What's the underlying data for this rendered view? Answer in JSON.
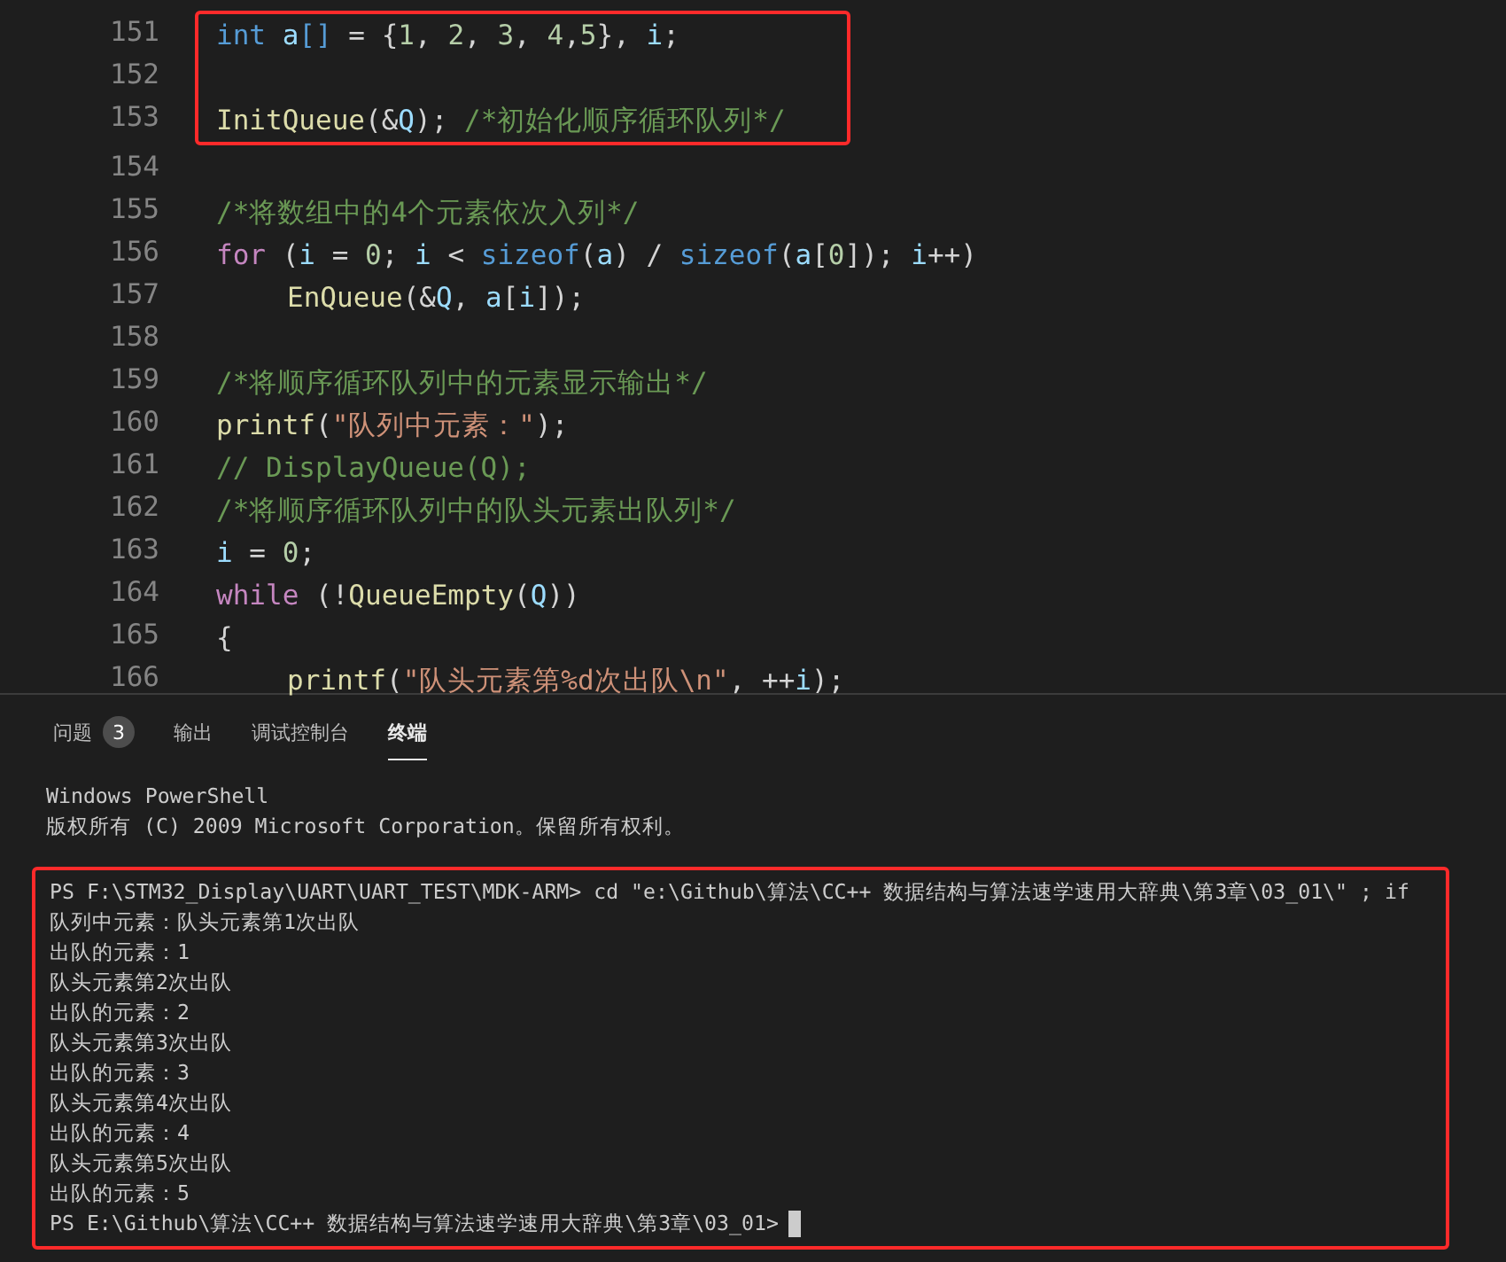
{
  "editor": {
    "lines": [
      {
        "number": "151",
        "highlighted": true,
        "tokens": [
          {
            "kind": "type",
            "text": "int"
          },
          {
            "kind": "var",
            "text": " a"
          },
          {
            "kind": "type",
            "text": "[]"
          },
          {
            "kind": "plain",
            "text": " = {"
          },
          {
            "kind": "num",
            "text": "1"
          },
          {
            "kind": "plain",
            "text": ", "
          },
          {
            "kind": "num",
            "text": "2"
          },
          {
            "kind": "plain",
            "text": ", "
          },
          {
            "kind": "num",
            "text": "3"
          },
          {
            "kind": "plain",
            "text": ", "
          },
          {
            "kind": "num",
            "text": "4"
          },
          {
            "kind": "plain",
            "text": ","
          },
          {
            "kind": "num",
            "text": "5"
          },
          {
            "kind": "plain",
            "text": "}, "
          },
          {
            "kind": "var",
            "text": "i"
          },
          {
            "kind": "plain",
            "text": ";"
          }
        ]
      },
      {
        "number": "152",
        "highlighted": true
      },
      {
        "number": "153",
        "highlighted": true,
        "tokens": [
          {
            "kind": "func",
            "text": "InitQueue"
          },
          {
            "kind": "plain",
            "text": "(&"
          },
          {
            "kind": "var",
            "text": "Q"
          },
          {
            "kind": "plain",
            "text": "); "
          },
          {
            "kind": "comment",
            "text": "/*初始化顺序循环队列*/"
          }
        ]
      },
      {
        "number": "154",
        "highlighted": false
      },
      {
        "number": "155",
        "highlighted": false,
        "tokens": [
          {
            "kind": "comment",
            "text": "/*将数组中的4个元素依次入列*/"
          }
        ]
      },
      {
        "number": "156",
        "highlighted": false,
        "tokens": [
          {
            "kind": "control",
            "text": "for"
          },
          {
            "kind": "plain",
            "text": " ("
          },
          {
            "kind": "var",
            "text": "i"
          },
          {
            "kind": "plain",
            "text": " = "
          },
          {
            "kind": "num",
            "text": "0"
          },
          {
            "kind": "plain",
            "text": "; "
          },
          {
            "kind": "var",
            "text": "i"
          },
          {
            "kind": "plain",
            "text": " < "
          },
          {
            "kind": "type",
            "text": "sizeof"
          },
          {
            "kind": "plain",
            "text": "("
          },
          {
            "kind": "var",
            "text": "a"
          },
          {
            "kind": "plain",
            "text": ") / "
          },
          {
            "kind": "type",
            "text": "sizeof"
          },
          {
            "kind": "plain",
            "text": "("
          },
          {
            "kind": "var",
            "text": "a"
          },
          {
            "kind": "plain",
            "text": "["
          },
          {
            "kind": "num",
            "text": "0"
          },
          {
            "kind": "plain",
            "text": "]); "
          },
          {
            "kind": "var",
            "text": "i"
          },
          {
            "kind": "plain",
            "text": "++)"
          }
        ]
      },
      {
        "number": "157",
        "highlighted": false,
        "indented": true,
        "tokens": [
          {
            "kind": "func",
            "text": "EnQueue"
          },
          {
            "kind": "plain",
            "text": "(&"
          },
          {
            "kind": "var",
            "text": "Q"
          },
          {
            "kind": "plain",
            "text": ", "
          },
          {
            "kind": "var",
            "text": "a"
          },
          {
            "kind": "plain",
            "text": "["
          },
          {
            "kind": "var",
            "text": "i"
          },
          {
            "kind": "plain",
            "text": "]);"
          }
        ]
      },
      {
        "number": "158",
        "highlighted": false
      },
      {
        "number": "159",
        "highlighted": false,
        "tokens": [
          {
            "kind": "comment",
            "text": "/*将顺序循环队列中的元素显示输出*/"
          }
        ]
      },
      {
        "number": "160",
        "highlighted": false,
        "tokens": [
          {
            "kind": "func",
            "text": "printf"
          },
          {
            "kind": "plain",
            "text": "("
          },
          {
            "kind": "string",
            "text": "\"队列中元素：\""
          },
          {
            "kind": "plain",
            "text": ");"
          }
        ]
      },
      {
        "number": "161",
        "highlighted": false,
        "tokens": [
          {
            "kind": "comment",
            "text": "// DisplayQueue(Q);"
          }
        ]
      },
      {
        "number": "162",
        "highlighted": false,
        "tokens": [
          {
            "kind": "comment",
            "text": "/*将顺序循环队列中的队头元素出队列*/"
          }
        ]
      },
      {
        "number": "163",
        "highlighted": false,
        "tokens": [
          {
            "kind": "var",
            "text": "i"
          },
          {
            "kind": "plain",
            "text": " = "
          },
          {
            "kind": "num",
            "text": "0"
          },
          {
            "kind": "plain",
            "text": ";"
          }
        ]
      },
      {
        "number": "164",
        "highlighted": false,
        "tokens": [
          {
            "kind": "control",
            "text": "while"
          },
          {
            "kind": "plain",
            "text": " (!"
          },
          {
            "kind": "func",
            "text": "QueueEmpty"
          },
          {
            "kind": "plain",
            "text": "("
          },
          {
            "kind": "var",
            "text": "Q"
          },
          {
            "kind": "plain",
            "text": "))"
          }
        ]
      },
      {
        "number": "165",
        "highlighted": false,
        "tokens": [
          {
            "kind": "plain",
            "text": "{"
          }
        ]
      },
      {
        "number": "166",
        "highlighted": false,
        "indented": true,
        "tokens": [
          {
            "kind": "func",
            "text": "printf"
          },
          {
            "kind": "plain",
            "text": "("
          },
          {
            "kind": "string",
            "text": "\"队头元素第%d次出队\\n\""
          },
          {
            "kind": "plain",
            "text": ", ++"
          },
          {
            "kind": "var",
            "text": "i"
          },
          {
            "kind": "plain",
            "text": ");"
          }
        ]
      }
    ]
  },
  "panel": {
    "tabs": [
      {
        "label": "问题",
        "badge": "3",
        "selected": false
      },
      {
        "label": "输出",
        "selected": false
      },
      {
        "label": "调试控制台",
        "selected": false
      },
      {
        "label": "终端",
        "selected": true
      }
    ],
    "terminal": {
      "header": [
        "Windows PowerShell",
        "版权所有 (C) 2009 Microsoft Corporation。保留所有权利。"
      ],
      "output_highlighted": true,
      "output": [
        "PS F:\\STM32_Display\\UART\\UART_TEST\\MDK-ARM> cd \"e:\\Github\\算法\\CC++ 数据结构与算法速学速用大辞典\\第3章\\03_01\\\" ; if",
        "队列中元素：队头元素第1次出队",
        "出队的元素：1",
        "队头元素第2次出队",
        "出队的元素：2",
        "队头元素第3次出队",
        "出队的元素：3",
        "队头元素第4次出队",
        "出队的元素：4",
        "队头元素第5次出队",
        "出队的元素：5"
      ],
      "prompt": "PS E:\\Github\\算法\\CC++ 数据结构与算法速学速用大辞典\\第3章\\03_01>"
    }
  }
}
